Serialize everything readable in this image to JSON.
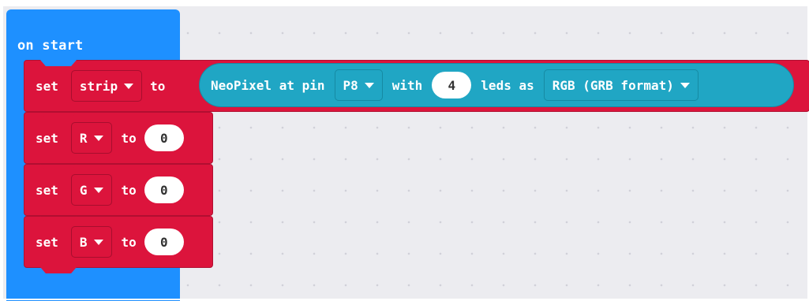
{
  "event_block": {
    "label": "on start"
  },
  "set_strip": {
    "set_label": "set",
    "variable": "strip",
    "to_label": "to",
    "neopixel": {
      "prefix": "NeoPixel at pin",
      "pin": "P8",
      "with_label": "with",
      "leds_count": "4",
      "leds_label": "leds as",
      "mode": "RGB (GRB format)"
    }
  },
  "set_r": {
    "set_label": "set",
    "variable": "R",
    "to_label": "to",
    "value": "0"
  },
  "set_g": {
    "set_label": "set",
    "variable": "G",
    "to_label": "to",
    "value": "0"
  },
  "set_b": {
    "set_label": "set",
    "variable": "B",
    "to_label": "to",
    "value": "0"
  },
  "colors": {
    "event_block": "#1e90ff",
    "variables_block": "#dc143c",
    "neopixel_block": "#20a6c4",
    "workspace": "#ececf0"
  }
}
